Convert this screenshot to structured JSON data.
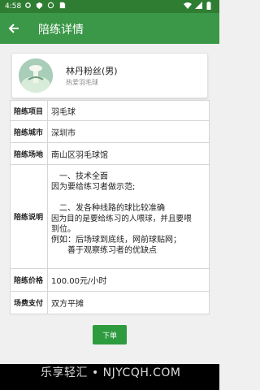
{
  "statusbar": {
    "time": "4:58"
  },
  "header": {
    "title": "陪练详情"
  },
  "profile": {
    "name": "林丹粉丝(男)",
    "subtitle": "热爱羽毛球"
  },
  "details": [
    {
      "label": "陪练项目",
      "value": "羽毛球"
    },
    {
      "label": "陪练城市",
      "value": "深圳市"
    },
    {
      "label": "陪练场地",
      "value": "南山区羽毛球馆"
    },
    {
      "label": "陪练说明",
      "lines": [
        "一、技术全面",
        "因为要给练习者做示范;",
        "",
        "二、发各种线路的球比较准确",
        "因为目的是要给练习的人喂球，并且要喂",
        "到位。",
        "例如：后场球到底线，网前球贴网；",
        "　　善于观察练习者的优缺点"
      ]
    },
    {
      "label": "陪练价格",
      "value": "100.00元/小时"
    },
    {
      "label": "场费支付",
      "value": "双方平摊"
    }
  ],
  "actions": {
    "order_label": "下单"
  },
  "watermark": "乐享轻汇 • NJYCQH.COM",
  "colors": {
    "appbar": "#3b9848",
    "statusbar": "#2e7d32",
    "button": "#2e9b3f"
  }
}
